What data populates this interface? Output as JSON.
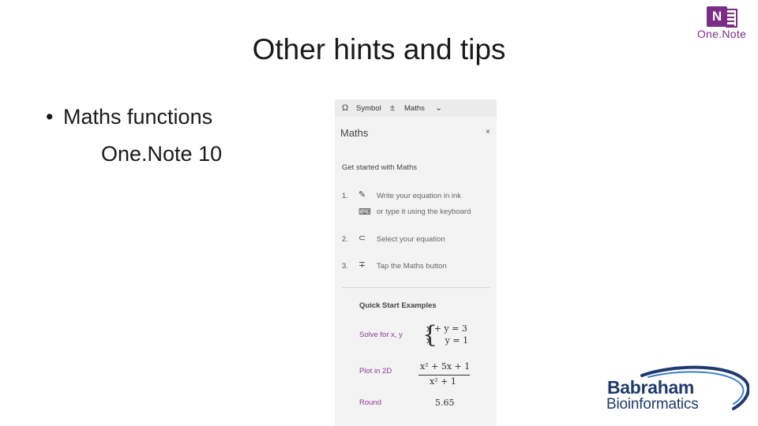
{
  "slide": {
    "title": "Other hints and tips",
    "bullet": "Maths functions",
    "sub": "One.Note 10"
  },
  "onenote_logo": {
    "letter": "N",
    "word": "One.Note",
    "color": "#7b2e87"
  },
  "panel": {
    "toolbar": {
      "symbol_label": "Symbol",
      "maths_label": "Maths"
    },
    "title": "Maths",
    "close": "×",
    "get_started": "Get started with Maths",
    "steps": [
      {
        "num": "1.",
        "text": "Write your equation in ink"
      },
      {
        "num": "",
        "text": "or type it using the keyboard"
      },
      {
        "num": "2.",
        "text": "Select your equation"
      },
      {
        "num": "3.",
        "text": "Tap the Maths button"
      }
    ],
    "quick_start": "Quick Start Examples",
    "examples": [
      {
        "label": "Solve for x, y",
        "line1": "x + y = 3",
        "line2": "x     y = 1"
      },
      {
        "label": "Plot in 2D",
        "numerator": "x² + 5x + 1",
        "denominator": "x² + 1"
      },
      {
        "label": "Round",
        "value": "5.65"
      }
    ]
  },
  "babraham_logo": {
    "line1": "Babraham",
    "line2": "Bioinformatics",
    "color": "#1f3b6e"
  }
}
